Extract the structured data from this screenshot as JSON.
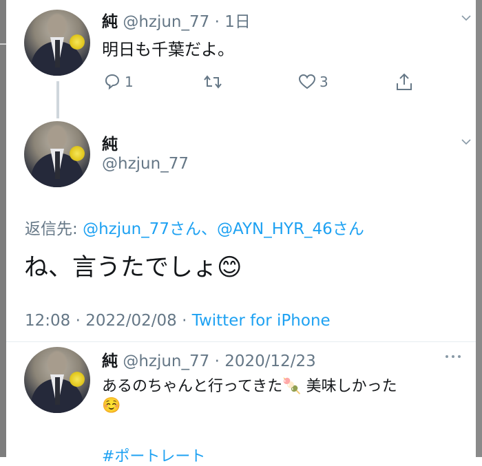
{
  "tweet1": {
    "name": "純",
    "handle_time": "@hzjun_77 · 1日",
    "text": "明日も千葉だよ。",
    "reply_count": "1",
    "like_count": "3"
  },
  "tweet2": {
    "name": "純",
    "handle": "@hzjun_77",
    "reply_label": "返信先:",
    "reply_to": "@hzjun_77さん、@AYN_HYR_46さん",
    "text": "ね、言うたでしょ😊",
    "time_date": "12:08 · 2022/02/08 · ",
    "client": "Twitter for iPhone"
  },
  "quote": {
    "name": "純",
    "handle_time": "@hzjun_77 · 2020/12/23",
    "text_line1": "あるのちゃんと行ってきた🍡 美味しかった",
    "text_line2": "☺️",
    "hashtag": "#ポートレート"
  },
  "colors": {
    "link": "#1da1f2",
    "muted": "#657786",
    "thread_line": "#cfd6dc"
  },
  "icons": [
    "reply-icon",
    "retweet-icon",
    "like-icon",
    "share-icon",
    "chevron-down-icon",
    "more-icon"
  ]
}
